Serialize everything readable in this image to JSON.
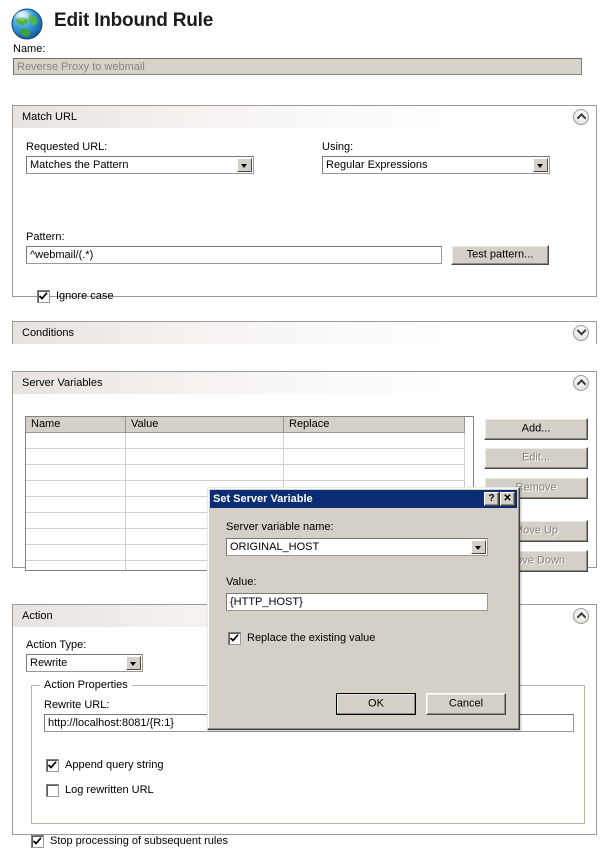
{
  "header": {
    "icon": "globe-icon",
    "title": "Edit Inbound Rule",
    "name_label": "Name:",
    "name_value": "Reverse Proxy to webmail"
  },
  "match_url": {
    "title": "Match URL",
    "collapse_icon": "chevron-up-icon",
    "requested_url_label": "Requested URL:",
    "requested_url_value": "Matches the Pattern",
    "using_label": "Using:",
    "using_value": "Regular Expressions",
    "pattern_label": "Pattern:",
    "pattern_value": "^webmail/(.*)",
    "test_pattern_label": "Test pattern...",
    "ignore_case_label": "Ignore case",
    "ignore_case_checked": true
  },
  "conditions": {
    "title": "Conditions",
    "collapse_icon": "chevron-down-icon"
  },
  "server_variables": {
    "title": "Server Variables",
    "collapse_icon": "chevron-up-icon",
    "columns": [
      "Name",
      "Value",
      "Replace"
    ],
    "rows": [],
    "empty_row_count": 10,
    "buttons": [
      {
        "label": "Add...",
        "enabled": true
      },
      {
        "label": "Edit...",
        "enabled": false
      },
      {
        "label": "Remove",
        "enabled": false
      },
      {
        "label": "Move Up",
        "enabled": false
      },
      {
        "label": "Move Down",
        "enabled": false
      }
    ]
  },
  "action": {
    "title": "Action",
    "collapse_icon": "chevron-up-icon",
    "action_type_label": "Action Type:",
    "action_type_value": "Rewrite",
    "properties_legend": "Action Properties",
    "rewrite_url_label": "Rewrite URL:",
    "rewrite_url_value": "http://localhost:8081/{R:1}",
    "append_query_label": "Append query string",
    "append_query_checked": true,
    "log_rewritten_label": "Log rewritten URL",
    "log_rewritten_checked": false,
    "stop_processing_label": "Stop processing of subsequent rules",
    "stop_processing_checked": true
  },
  "dialog": {
    "title": "Set Server Variable",
    "help_button": "?",
    "close_button": "✕",
    "variable_name_label": "Server variable name:",
    "variable_name_value": "ORIGINAL_HOST",
    "value_label": "Value:",
    "value_value": "{HTTP_HOST}",
    "replace_label": "Replace the existing value",
    "replace_checked": true,
    "ok_label": "OK",
    "cancel_label": "Cancel"
  },
  "colors": {
    "titlebar": "#0b2d74",
    "face": "#d4d0c8",
    "section_border": "#9c9a94",
    "disabled_text": "#878480"
  }
}
